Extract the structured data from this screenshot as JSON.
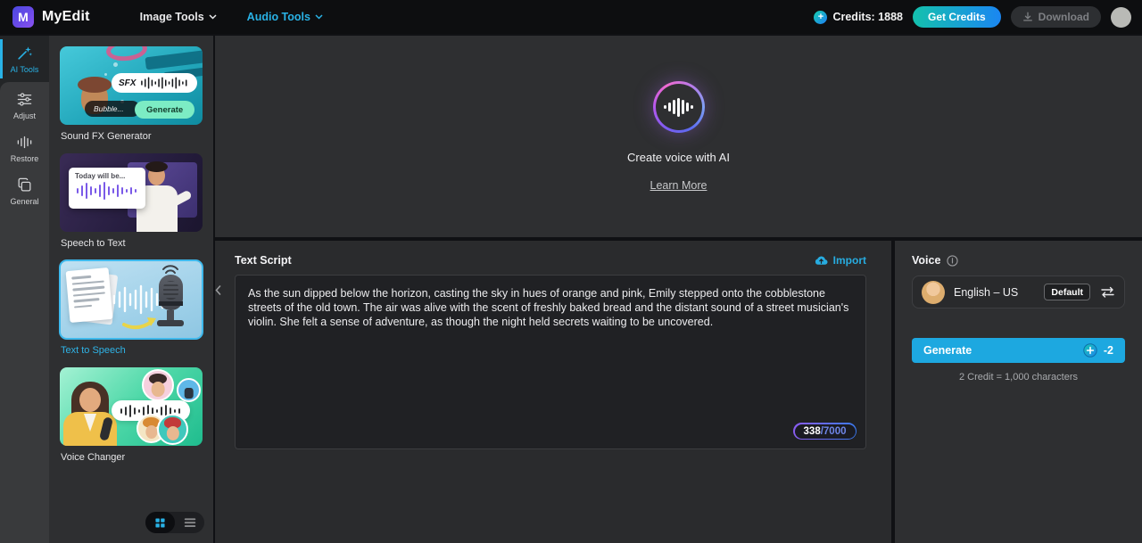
{
  "colors": {
    "accent_cyan": "#29b2e6",
    "generate_blue": "#1da8e0",
    "get_credits_gradient": [
      "#14c1ad",
      "#1b86f2"
    ],
    "selected_border": "#3fb9ec"
  },
  "navbar": {
    "brand": "MyEdit",
    "image_tools": "Image Tools",
    "audio_tools": "Audio Tools",
    "credits": "Credits: 1888",
    "get_credits": "Get Credits",
    "download": "Download"
  },
  "rail": {
    "items": [
      {
        "label": "AI Tools"
      },
      {
        "label": "Adjust"
      },
      {
        "label": "Restore"
      },
      {
        "label": "General"
      }
    ]
  },
  "library": {
    "items": [
      {
        "label": "Sound FX Generator",
        "sfx_badge": "SFX",
        "tag": "Bubble...",
        "button": "Generate"
      },
      {
        "label": "Speech to Text",
        "caption": "Today will be..."
      },
      {
        "label": "Text to Speech"
      },
      {
        "label": "Voice Changer"
      }
    ]
  },
  "hero": {
    "title": "Create voice with AI",
    "link": "Learn More"
  },
  "script": {
    "title": "Text Script",
    "import_label": "Import",
    "text": "As the sun dipped below the horizon, casting the sky in hues of orange and pink, Emily stepped onto the cobblestone streets of the old town. The air was alive with the scent of freshly baked bread and the distant sound of a street musician's violin. She felt a sense of adventure, as though the night held secrets waiting to be uncovered.",
    "char_count": "338",
    "char_limit": "/7000"
  },
  "voice": {
    "title": "Voice",
    "name": "English – US",
    "default_badge": "Default",
    "generate": "Generate",
    "cost": "-2",
    "note": "2 Credit = 1,000 characters"
  }
}
